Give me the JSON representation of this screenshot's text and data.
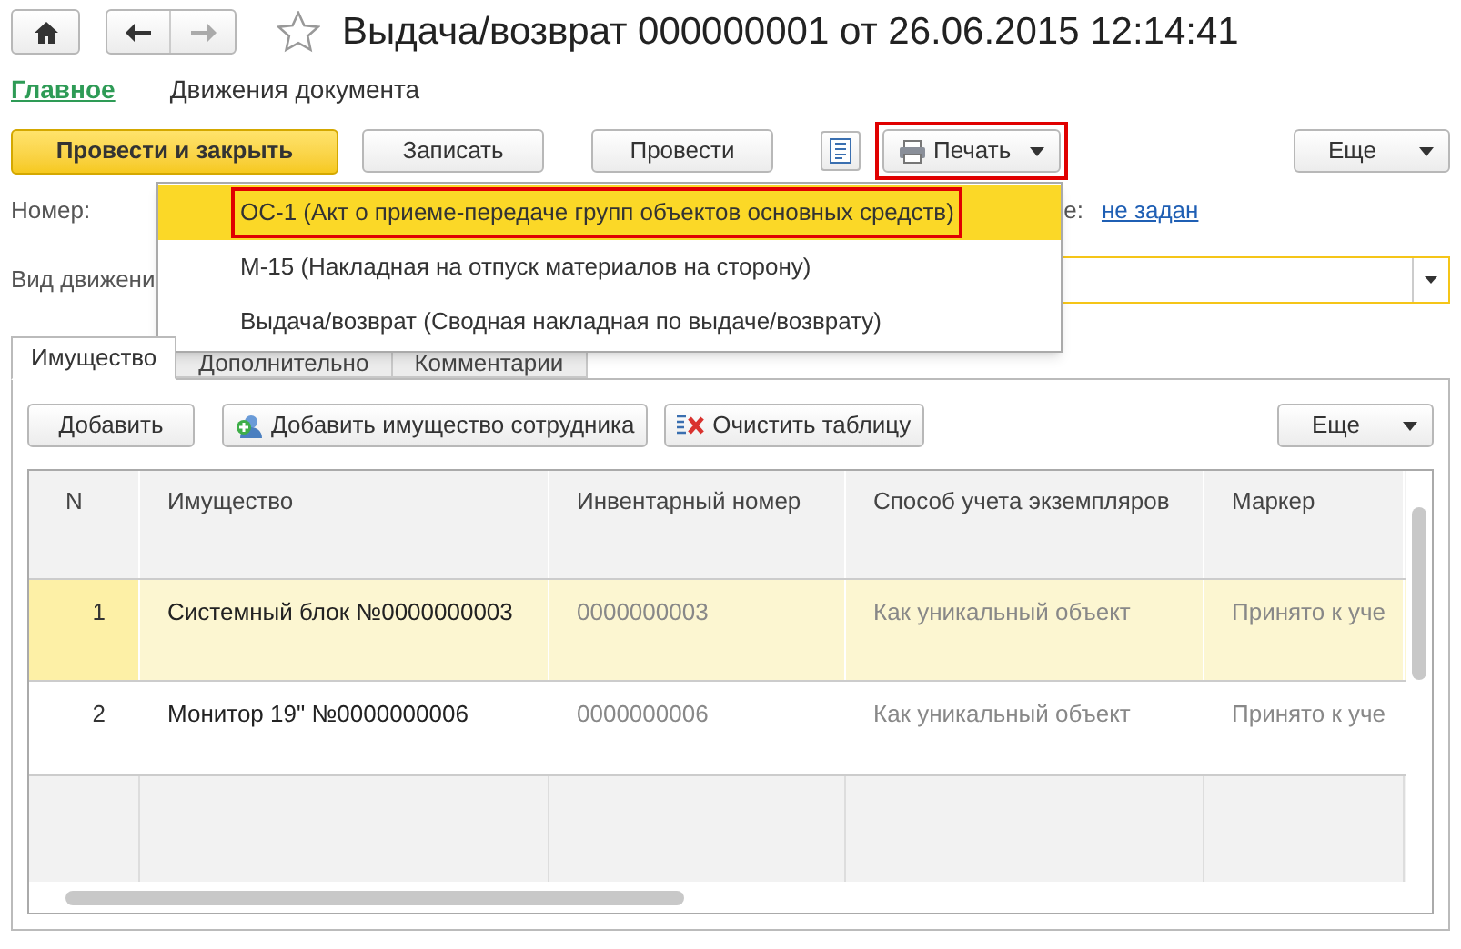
{
  "header": {
    "title": "Выдача/возврат 000000001 от 26.06.2015 12:14:41"
  },
  "sections": [
    {
      "label": "Главное",
      "selected": true
    },
    {
      "label": "Движения документа",
      "selected": false
    }
  ],
  "toolbar": [
    {
      "kind": "primary",
      "label": "Провести и закрыть"
    },
    {
      "kind": "plain",
      "label": "Записать"
    },
    {
      "kind": "plain",
      "label": "Провести"
    },
    {
      "kind": "icon"
    },
    {
      "kind": "print",
      "label": "Печать",
      "highlighted": true
    },
    {
      "kind": "more",
      "label": "Еще"
    }
  ],
  "fields": {
    "number_label": "Номер:",
    "right_label": "е:",
    "right_value": "не задан",
    "movement_label": "Вид движени"
  },
  "print_menu": [
    {
      "label": "ОС-1 (Акт о приеме-передаче групп объектов основных средств)",
      "selected": true,
      "highlighted": true
    },
    {
      "label": "М-15 (Накладная на отпуск материалов на сторону)",
      "selected": false,
      "highlighted": false
    },
    {
      "label": "Выдача/возврат (Сводная накладная по выдаче/возврату)",
      "selected": false,
      "highlighted": false
    }
  ],
  "tabs": [
    {
      "label": "Имущество",
      "selected": true
    },
    {
      "label": "Дополнительно",
      "selected": false
    },
    {
      "label": "Комментарии",
      "selected": false
    }
  ],
  "table_toolbar": [
    {
      "kind": "plain",
      "label": "Добавить"
    },
    {
      "kind": "add_employee",
      "label": "Добавить имущество сотрудника"
    },
    {
      "kind": "clear",
      "label": "Очистить таблицу"
    },
    {
      "kind": "more",
      "label": "Еще"
    }
  ],
  "table": {
    "columns": [
      "N",
      "Имущество",
      "Инвентарный номер",
      "Способ учета экземпляров",
      "Маркер"
    ],
    "rows": [
      {
        "cells": [
          "1",
          "Системный блок №0000000003",
          "0000000003",
          "Как уникальный объект",
          "Принято к уче"
        ],
        "selected": true
      },
      {
        "cells": [
          "2",
          "Монитор 19\" №0000000006",
          "0000000006",
          "Как уникальный объект",
          "Принято к уче"
        ],
        "selected": false
      }
    ]
  }
}
